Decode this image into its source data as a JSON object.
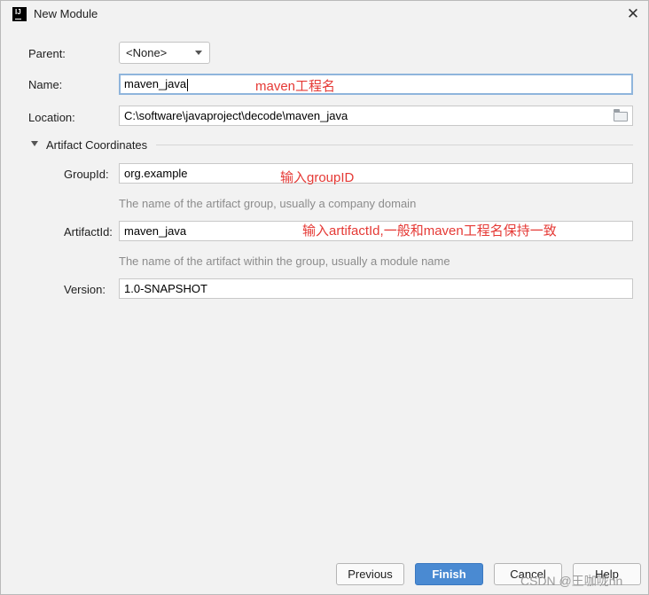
{
  "window": {
    "title": "New Module",
    "app_icon_text": "IJ",
    "close_symbol": "✕"
  },
  "form": {
    "parent": {
      "label": "Parent:",
      "value": "<None>"
    },
    "name": {
      "label": "Name:",
      "value": "maven_java"
    },
    "location": {
      "label": "Location:",
      "value": "C:\\software\\javaproject\\decode\\maven_java"
    }
  },
  "artifact_coordinates": {
    "title": "Artifact Coordinates",
    "expanded": true,
    "group_id": {
      "label": "GroupId:",
      "value": "org.example",
      "hint": "The name of the artifact group, usually a company domain"
    },
    "artifact_id": {
      "label": "ArtifactId:",
      "value": "maven_java",
      "hint": "The name of the artifact within the group, usually a module name"
    },
    "version": {
      "label": "Version:",
      "value": "1.0-SNAPSHOT"
    }
  },
  "annotations": {
    "name_note": "maven工程名",
    "group_note": "输入groupID",
    "artifact_note": "输入artifactId,一般和maven工程名保持一致"
  },
  "buttons": {
    "previous": "Previous",
    "finish": "Finish",
    "cancel": "Cancel",
    "help": "Help"
  },
  "watermark": "CSDN @王咖咙nn",
  "colors": {
    "annotation": "#e53935",
    "primary_button": "#4a8ad2",
    "focus_border": "#8fb5dc"
  },
  "icons": {
    "folder": "folder-open-icon",
    "expand": "triangle-down-icon",
    "dropdown": "chevron-down-icon"
  }
}
